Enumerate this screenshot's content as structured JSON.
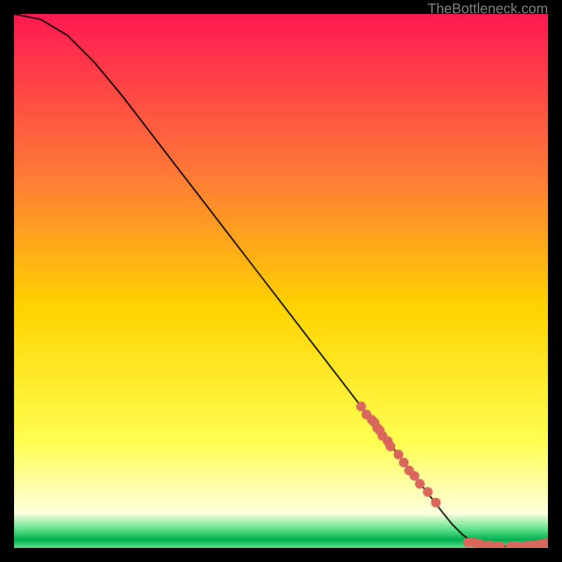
{
  "watermark": "TheBottleneck.com",
  "chart_data": {
    "type": "line",
    "title": "",
    "xlabel": "",
    "ylabel": "",
    "xlim": [
      0,
      100
    ],
    "ylim": [
      0,
      100
    ],
    "x": [
      0,
      5,
      10,
      15,
      20,
      25,
      30,
      35,
      40,
      45,
      50,
      55,
      60,
      65,
      70,
      75,
      80,
      82,
      84,
      86,
      88,
      90,
      92,
      94,
      96,
      98,
      100
    ],
    "y": [
      100,
      99,
      96,
      91,
      85,
      78.5,
      72,
      65.5,
      59,
      52.5,
      46,
      39.5,
      33,
      26.5,
      20,
      13.5,
      7,
      4.5,
      2.5,
      1,
      0.5,
      0.3,
      0.3,
      0.3,
      0.4,
      0.6,
      1
    ],
    "scatter_points": {
      "x": [
        65,
        66,
        67,
        67.5,
        68,
        68.5,
        69,
        70,
        70.5,
        72,
        73,
        74,
        75,
        76,
        77.5,
        79,
        85,
        86,
        87,
        87.5,
        89,
        90.5,
        91,
        93,
        94,
        94.5,
        96,
        97,
        98,
        99,
        100
      ],
      "y": [
        26.5,
        25,
        24,
        23.5,
        22.5,
        22,
        21,
        20,
        19,
        17.5,
        16,
        14.5,
        13.5,
        12,
        10.5,
        8.5,
        1,
        1,
        0.8,
        0.6,
        0.5,
        0.3,
        0.3,
        0.3,
        0.3,
        0.3,
        0.4,
        0.5,
        0.6,
        0.8,
        1
      ]
    },
    "gradient_colors": {
      "top": "#ff1a52",
      "mid_upper": "#ff7a36",
      "mid": "#ffd400",
      "mid_lower": "#ffff50",
      "near_bottom": "#ffffe0",
      "bottom_band": "#5fe38a",
      "bottom_line": "#00b050"
    },
    "marker_color": "#d9675c",
    "curve_color": "#000000"
  }
}
